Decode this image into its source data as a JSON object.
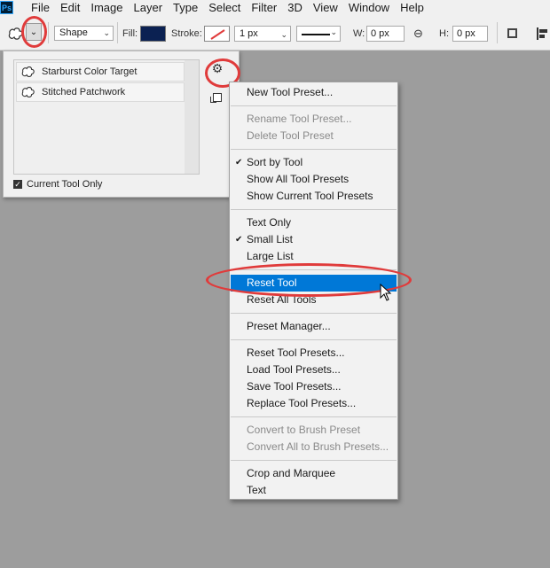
{
  "app": {
    "logo": "Ps"
  },
  "menubar": {
    "items": [
      "File",
      "Edit",
      "Image",
      "Layer",
      "Type",
      "Select",
      "Filter",
      "3D",
      "View",
      "Window",
      "Help"
    ]
  },
  "options": {
    "mode": "Shape",
    "fill_label": "Fill:",
    "fill_color": "#0b2152",
    "stroke_label": "Stroke:",
    "stroke_size": "1 px",
    "w_label": "W:",
    "w_value": "0 px",
    "h_label": "H:",
    "h_value": "0 px"
  },
  "preset_panel": {
    "presets": [
      "Starburst Color Target",
      "Stitched Patchwork"
    ],
    "current_tool_only_label": "Current Tool Only",
    "current_tool_only_checked": true
  },
  "context_menu": {
    "items": [
      {
        "label": "New Tool Preset...",
        "disabled": false,
        "checked": false
      },
      {
        "label": "Rename Tool Preset...",
        "disabled": true,
        "checked": false
      },
      {
        "label": "Delete Tool Preset",
        "disabled": true,
        "checked": false
      },
      {
        "label": "Sort by Tool",
        "disabled": false,
        "checked": true
      },
      {
        "label": "Show All Tool Presets",
        "disabled": false,
        "checked": false
      },
      {
        "label": "Show Current Tool Presets",
        "disabled": false,
        "checked": false
      },
      {
        "label": "Text Only",
        "disabled": false,
        "checked": false
      },
      {
        "label": "Small List",
        "disabled": false,
        "checked": true
      },
      {
        "label": "Large List",
        "disabled": false,
        "checked": false
      },
      {
        "label": "Reset Tool",
        "disabled": false,
        "checked": false,
        "highlighted": true
      },
      {
        "label": "Reset All Tools",
        "disabled": false,
        "checked": false
      },
      {
        "label": "Preset Manager...",
        "disabled": false,
        "checked": false
      },
      {
        "label": "Reset Tool Presets...",
        "disabled": false,
        "checked": false
      },
      {
        "label": "Load Tool Presets...",
        "disabled": false,
        "checked": false
      },
      {
        "label": "Save Tool Presets...",
        "disabled": false,
        "checked": false
      },
      {
        "label": "Replace Tool Presets...",
        "disabled": false,
        "checked": false
      },
      {
        "label": "Convert to Brush Preset",
        "disabled": true,
        "checked": false
      },
      {
        "label": "Convert All to Brush Presets...",
        "disabled": true,
        "checked": false
      },
      {
        "label": "Crop and Marquee",
        "disabled": false,
        "checked": false
      },
      {
        "label": "Text",
        "disabled": false,
        "checked": false
      }
    ],
    "check_glyph": "✔"
  },
  "colors": {
    "highlight": "#0078d7",
    "annotation_ring": "#e03b3b"
  }
}
